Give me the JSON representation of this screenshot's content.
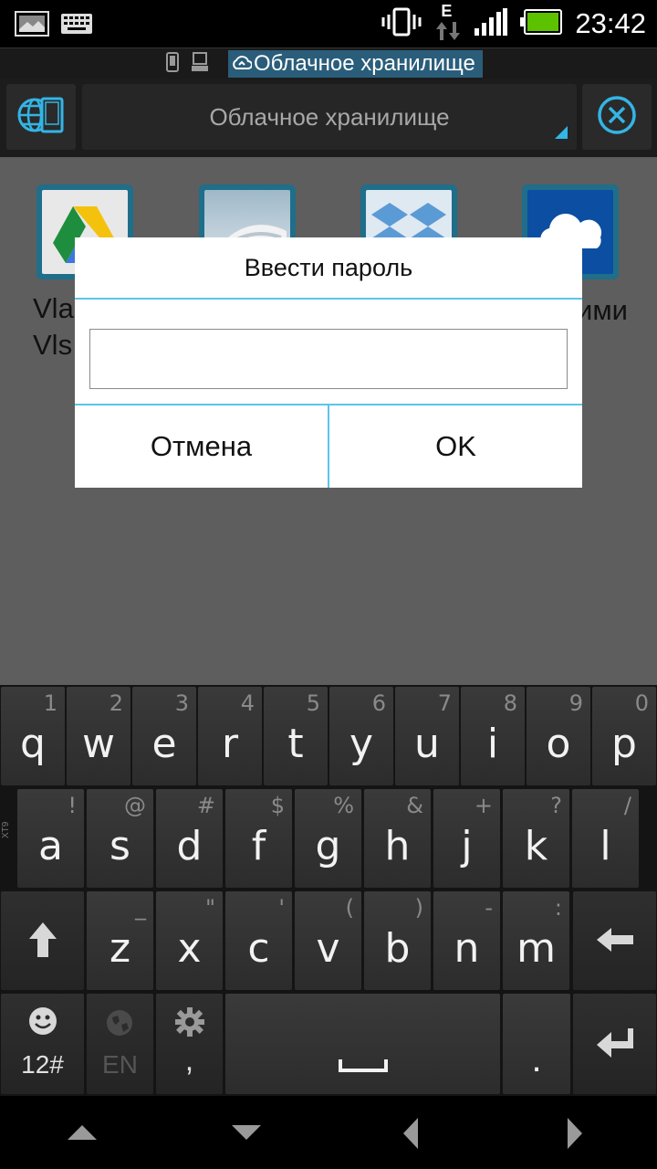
{
  "status_bar": {
    "time": "23:42",
    "network_type": "E",
    "icons": [
      "gallery-icon",
      "keyboard-icon",
      "vibrate-icon",
      "data-transfer-icon",
      "signal-icon",
      "battery-icon"
    ],
    "battery_color": "#5cc200"
  },
  "path_bar": {
    "icons": [
      "phone-icon",
      "device-icon",
      "cloud-icon"
    ],
    "current": "Облачное хранилище",
    "highlight_color": "#2a5d7a"
  },
  "toolbar": {
    "left_icon": "globe-tablet-icon",
    "spinner_label": "Облачное хранилище",
    "close_icon": "close-circle-icon",
    "accent": "#33b5e5"
  },
  "content": {
    "items": [
      {
        "icon": "google-drive-icon",
        "label_line1": "Vla",
        "label_line2": "Vls"
      },
      {
        "icon": "cloud-service-icon"
      },
      {
        "icon": "dropbox-icon"
      },
      {
        "icon": "onedrive-icon",
        "label_line1": "ими"
      }
    ]
  },
  "dialog": {
    "title": "Ввести пароль",
    "input_value": "",
    "cancel_label": "Отмена",
    "ok_label": "OK"
  },
  "keyboard": {
    "row1": [
      {
        "main": "q",
        "alt": "1"
      },
      {
        "main": "w",
        "alt": "2"
      },
      {
        "main": "e",
        "alt": "3"
      },
      {
        "main": "r",
        "alt": "4"
      },
      {
        "main": "t",
        "alt": "5"
      },
      {
        "main": "y",
        "alt": "6"
      },
      {
        "main": "u",
        "alt": "7"
      },
      {
        "main": "i",
        "alt": "8"
      },
      {
        "main": "o",
        "alt": "9"
      },
      {
        "main": "p",
        "alt": "0"
      }
    ],
    "row2": [
      {
        "main": "a",
        "alt": "!"
      },
      {
        "main": "s",
        "alt": "@"
      },
      {
        "main": "d",
        "alt": "#"
      },
      {
        "main": "f",
        "alt": "$"
      },
      {
        "main": "g",
        "alt": "%"
      },
      {
        "main": "h",
        "alt": "&"
      },
      {
        "main": "j",
        "alt": "+"
      },
      {
        "main": "k",
        "alt": "?"
      },
      {
        "main": "l",
        "alt": "/"
      }
    ],
    "row3": [
      {
        "main": "z",
        "alt": "_"
      },
      {
        "main": "x",
        "alt": "\""
      },
      {
        "main": "c",
        "alt": "'"
      },
      {
        "main": "v",
        "alt": "("
      },
      {
        "main": "b",
        "alt": ")"
      },
      {
        "main": "n",
        "alt": "-"
      },
      {
        "main": "m",
        "alt": ":"
      }
    ],
    "side_label": "XT9",
    "symbols_label": "12#",
    "language_label": "EN",
    "comma_label": ",",
    "period_label": "."
  },
  "nav_bar": {
    "icons": [
      "nav-up-icon",
      "nav-down-icon",
      "nav-left-icon",
      "nav-right-icon"
    ]
  }
}
